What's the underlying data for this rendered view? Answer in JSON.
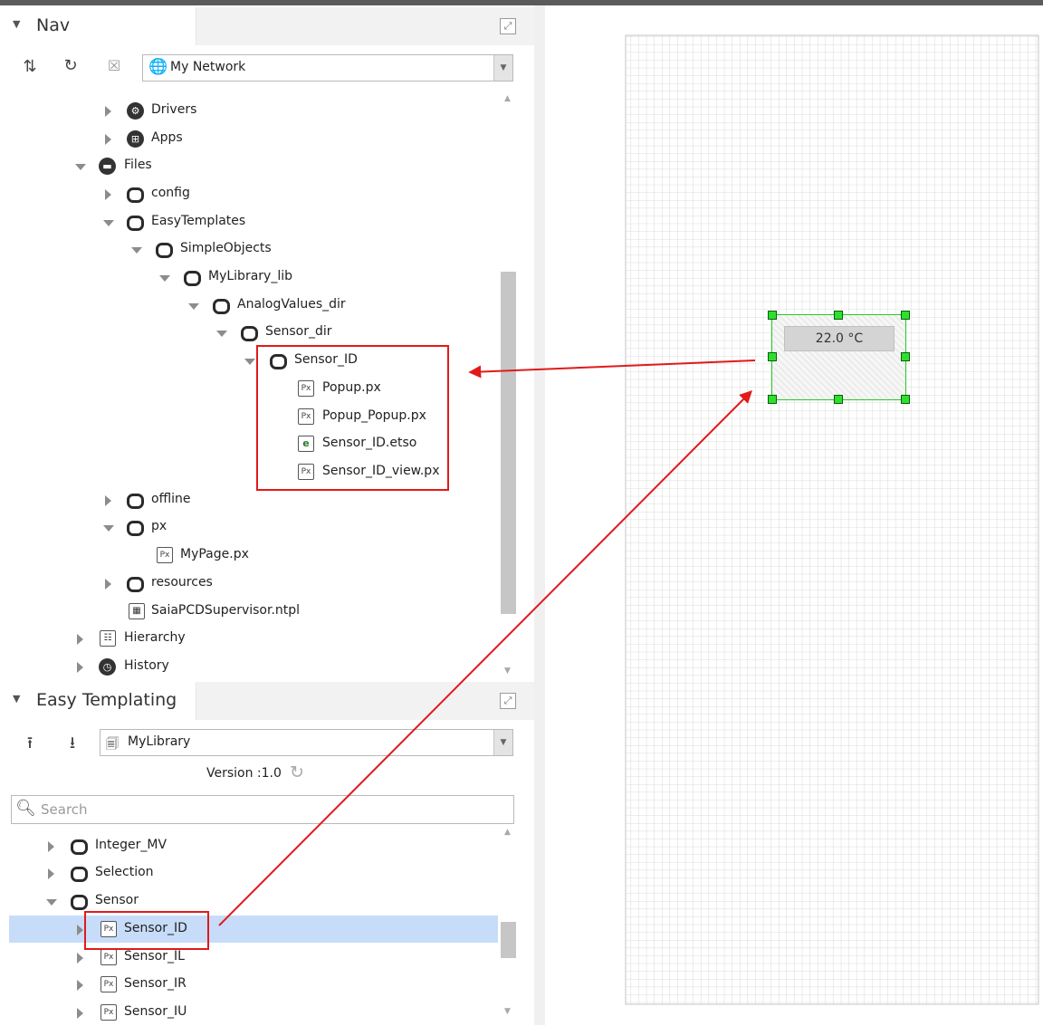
{
  "nav_panel": {
    "title": "Nav",
    "network_combo": "My Network",
    "tree": [
      {
        "label": "Drivers"
      },
      {
        "label": "Apps"
      },
      {
        "label": "Files"
      },
      {
        "label": "config"
      },
      {
        "label": "EasyTemplates"
      },
      {
        "label": "SimpleObjects"
      },
      {
        "label": "MyLibrary_lib"
      },
      {
        "label": "AnalogValues_dir"
      },
      {
        "label": "Sensor_dir"
      },
      {
        "label": "Sensor_ID"
      },
      {
        "label": "Popup.px"
      },
      {
        "label": "Popup_Popup.px"
      },
      {
        "label": "Sensor_ID.etso"
      },
      {
        "label": "Sensor_ID_view.px"
      },
      {
        "label": "offline"
      },
      {
        "label": "px"
      },
      {
        "label": "MyPage.px"
      },
      {
        "label": "resources"
      },
      {
        "label": "SaiaPCDSupervisor.ntpl"
      },
      {
        "label": "Hierarchy"
      },
      {
        "label": "History"
      }
    ]
  },
  "templating_panel": {
    "title": "Easy Templating",
    "library_combo": "MyLibrary",
    "version_text": "Version :1.0",
    "search_placeholder": "Search",
    "tree": [
      {
        "label": "Integer_MV"
      },
      {
        "label": "Selection"
      },
      {
        "label": "Sensor"
      },
      {
        "label": "Sensor_ID"
      },
      {
        "label": "Sensor_IL"
      },
      {
        "label": "Sensor_IR"
      },
      {
        "label": "Sensor_IU"
      }
    ]
  },
  "canvas": {
    "widget_value": "22.0 °C"
  },
  "icons": {
    "sort": "sort-icon",
    "refresh": "refresh-icon",
    "close": "close-icon",
    "globe": "globe-icon",
    "upload": "upload-icon",
    "download": "download-icon",
    "search": "search-icon",
    "maximize": "maximize-icon"
  },
  "colors": {
    "highlight": "#e11a1a",
    "selection": "#c7dcf9",
    "handle": "#2ee02e"
  }
}
